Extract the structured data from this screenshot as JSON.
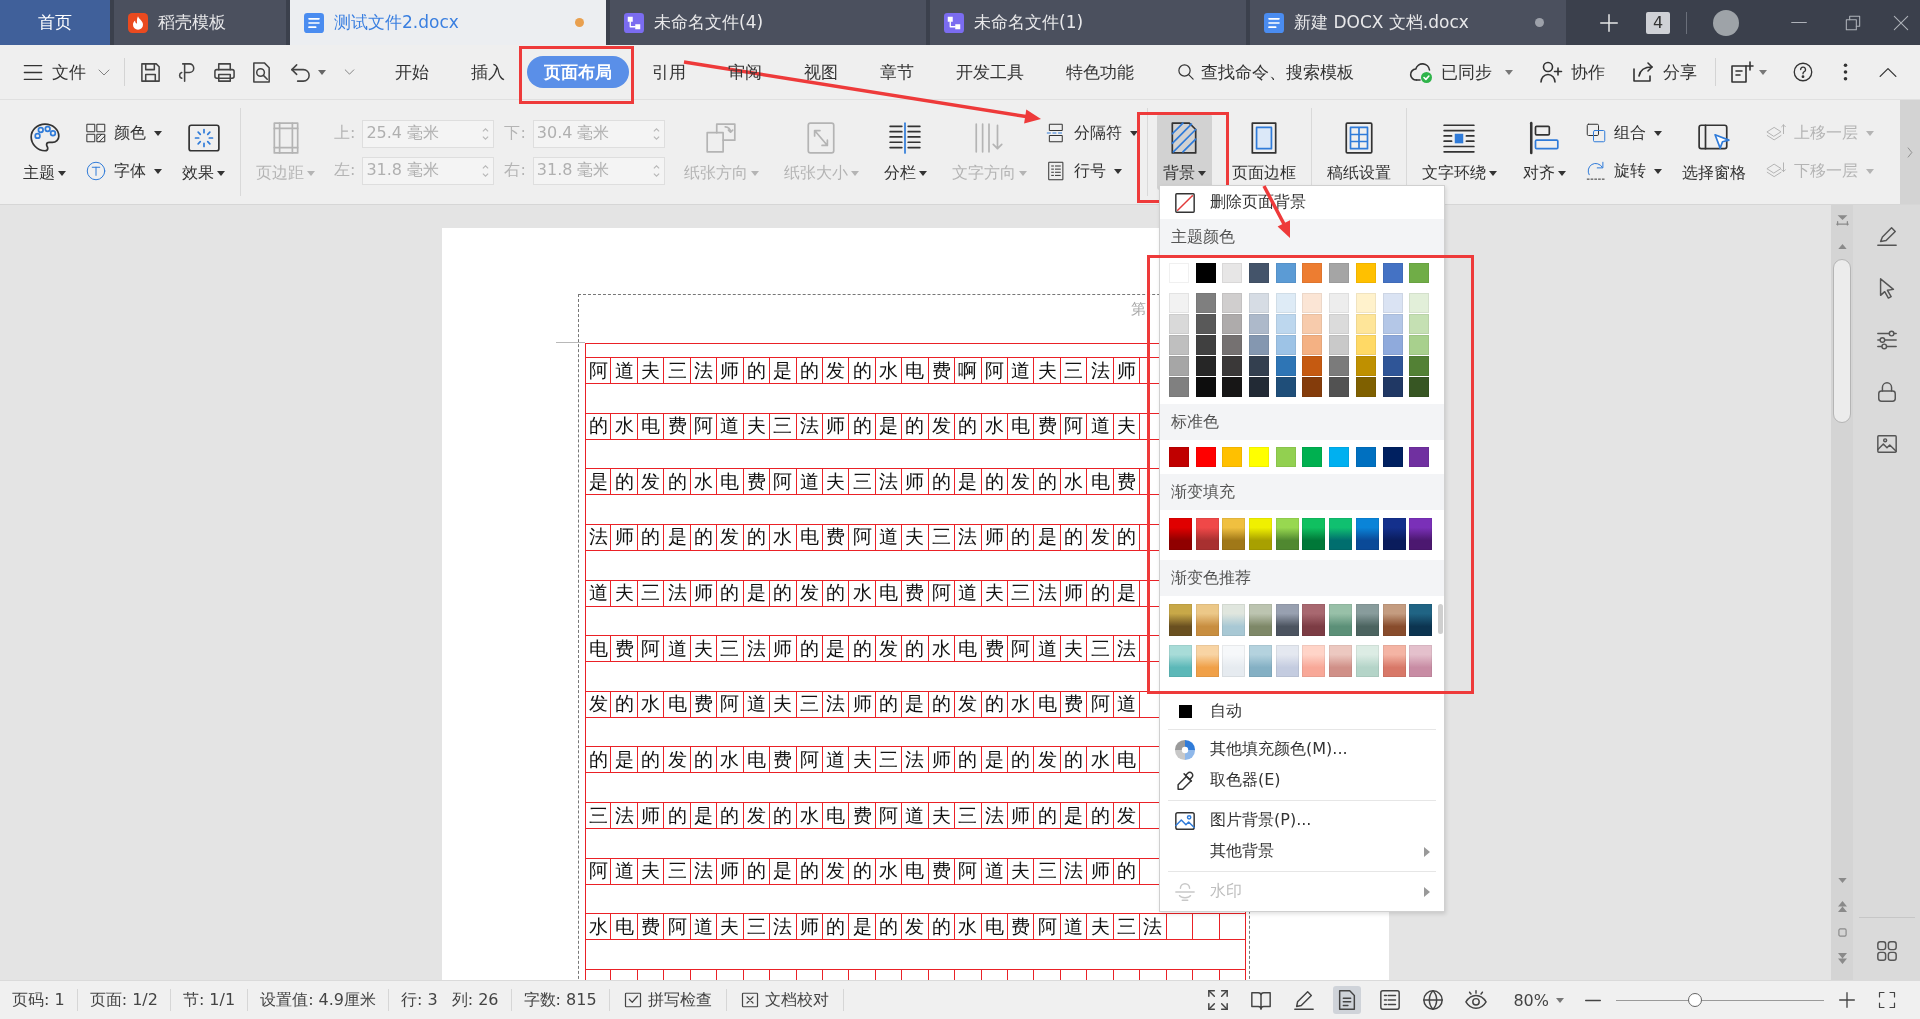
{
  "tab_bar": {
    "tabs": [
      {
        "label": "首页",
        "kind": "home",
        "selected": false,
        "modified": false
      },
      {
        "label": "稻壳模板",
        "kind": "template",
        "selected": false,
        "modified": false
      },
      {
        "label": "测试文件2.docx",
        "kind": "writer",
        "selected": true,
        "modified": true
      },
      {
        "label": "未命名文件(4)",
        "kind": "flowchart",
        "selected": false,
        "modified": false
      },
      {
        "label": "未命名文件(1)",
        "kind": "flowchart",
        "selected": false,
        "modified": false
      },
      {
        "label": "新建 DOCX 文档.docx",
        "kind": "writer",
        "selected": false,
        "modified": true
      }
    ],
    "window_count": "4"
  },
  "menu_bar": {
    "file_label": "文件",
    "tabs": [
      {
        "label": "开始",
        "selected": false,
        "marked": false
      },
      {
        "label": "插入",
        "selected": false,
        "marked": false
      },
      {
        "label": "页面布局",
        "selected": true,
        "marked": true
      },
      {
        "label": "引用",
        "selected": false,
        "marked": false
      },
      {
        "label": "审阅",
        "selected": false,
        "marked": false
      },
      {
        "label": "视图",
        "selected": false,
        "marked": false
      },
      {
        "label": "章节",
        "selected": false,
        "marked": false
      },
      {
        "label": "开发工具",
        "selected": false,
        "marked": false
      },
      {
        "label": "特色功能",
        "selected": false,
        "marked": false
      }
    ],
    "search_label": "查找命令、搜索模板",
    "sync_label": "已同步",
    "collaborate_label": "协作",
    "share_label": "分享"
  },
  "ribbon": {
    "groups": [
      {
        "items": [
          {
            "kind": "large",
            "label": "主题",
            "dropdown": true,
            "disabled": false,
            "selected": false,
            "marked": false
          },
          {
            "kind": "pair",
            "buttons": [
              {
                "label": "颜色",
                "dropdown": true,
                "disabled": false
              },
              {
                "label": "字体",
                "dropdown": true,
                "disabled": false
              }
            ]
          },
          {
            "kind": "large",
            "label": "效果",
            "dropdown": true,
            "disabled": false,
            "selected": false,
            "marked": false
          }
        ]
      },
      {
        "items": [
          {
            "kind": "large",
            "label": "页边距",
            "dropdown": true,
            "disabled": true,
            "selected": false,
            "marked": false
          },
          {
            "kind": "fields",
            "fields": [
              {
                "label": "上:",
                "value": "25.4 毫米",
                "disabled": true
              },
              {
                "label": "左:",
                "value": "31.8 毫米",
                "disabled": true
              },
              {
                "label": "下:",
                "value": "30.4 毫米",
                "disabled": true
              },
              {
                "label": "右:",
                "value": "31.8 毫米",
                "disabled": true
              }
            ]
          },
          {
            "kind": "large",
            "label": "纸张方向",
            "dropdown": true,
            "disabled": true,
            "selected": false,
            "marked": false
          },
          {
            "kind": "large",
            "label": "纸张大小",
            "dropdown": true,
            "disabled": true,
            "selected": false,
            "marked": false
          },
          {
            "kind": "large",
            "label": "分栏",
            "dropdown": true,
            "disabled": false,
            "selected": false,
            "marked": false
          },
          {
            "kind": "large",
            "label": "文字方向",
            "dropdown": true,
            "disabled": true,
            "selected": false,
            "marked": false
          },
          {
            "kind": "pair",
            "buttons": [
              {
                "label": "分隔符",
                "dropdown": true,
                "disabled": false
              },
              {
                "label": "行号",
                "dropdown": true,
                "disabled": false
              }
            ]
          }
        ]
      },
      {
        "items": [
          {
            "kind": "large",
            "label": "背景",
            "dropdown": true,
            "disabled": false,
            "selected": true,
            "marked": true
          },
          {
            "kind": "large",
            "label": "页面边框",
            "dropdown": false,
            "disabled": false,
            "selected": false,
            "marked": false
          }
        ]
      },
      {
        "items": [
          {
            "kind": "large",
            "label": "稿纸设置",
            "dropdown": false,
            "disabled": false,
            "selected": false,
            "marked": false
          }
        ]
      },
      {
        "items": [
          {
            "kind": "large",
            "label": "文字环绕",
            "dropdown": true,
            "disabled": false,
            "selected": false,
            "marked": false
          },
          {
            "kind": "large",
            "label": "对齐",
            "dropdown": true,
            "disabled": false,
            "selected": false,
            "marked": false
          },
          {
            "kind": "pair",
            "buttons": [
              {
                "label": "组合",
                "dropdown": true,
                "disabled": false
              },
              {
                "label": "旋转",
                "dropdown": true,
                "disabled": false
              }
            ]
          },
          {
            "kind": "large",
            "label": "选择窗格",
            "dropdown": false,
            "disabled": false,
            "selected": false,
            "marked": false
          },
          {
            "kind": "pair",
            "buttons": [
              {
                "label": "上移一层",
                "dropdown": true,
                "disabled": true
              },
              {
                "label": "下移一层",
                "dropdown": true,
                "disabled": true
              }
            ]
          }
        ]
      }
    ]
  },
  "document": {
    "header_text": "第",
    "grid_rows": [
      "阿道夫三法师的是的发的水电费啊阿道夫三法师",
      "的水电费阿道夫三法师的是的发的水电费阿道夫",
      "是的发的水电费阿道夫三法师的是的发的水电费",
      "法师的是的发的水电费阿道夫三法师的是的发的",
      "道夫三法师的是的发的水电费阿道夫三法师的是",
      "电费阿道夫三法师的是的发的水电费阿道夫三法",
      "发的水电费阿道夫三法师的是的发的水电费阿道",
      "的是的发的水电费阿道夫三法师的是的发的水电",
      "三法师的是的发的水电费阿道夫三法师的是的发",
      "阿道夫三法师的是的发的水电费阿道夫三法师的",
      "水电费阿道夫三法师的是的发的水电费阿道夫三法"
    ]
  },
  "background_menu": {
    "remove_label": "删除页面背景",
    "marked": true,
    "sections": [
      {
        "title": "主题颜色",
        "kind": "theme",
        "rows": [
          [
            {
              "color": "#ffffff"
            },
            {
              "color": "#000000"
            },
            {
              "color": "#e7e6e6"
            },
            {
              "color": "#44546a"
            },
            {
              "color": "#5b9bd5"
            },
            {
              "color": "#ed7d31"
            },
            {
              "color": "#a5a5a5"
            },
            {
              "color": "#ffc000"
            },
            {
              "color": "#4472c4"
            },
            {
              "color": "#70ad47"
            }
          ],
          [
            {
              "color": "#f2f2f2"
            },
            {
              "color": "#7f7f7f"
            },
            {
              "color": "#d0cece"
            },
            {
              "color": "#d6dce4"
            },
            {
              "color": "#deebf6"
            },
            {
              "color": "#fbe5d5"
            },
            {
              "color": "#ededed"
            },
            {
              "color": "#fff2cc"
            },
            {
              "color": "#dae3f3"
            },
            {
              "color": "#e2efd9"
            }
          ],
          [
            {
              "color": "#d9d9d9"
            },
            {
              "color": "#595959"
            },
            {
              "color": "#aeabab"
            },
            {
              "color": "#adb9ca"
            },
            {
              "color": "#bdd7ee"
            },
            {
              "color": "#f7cbac"
            },
            {
              "color": "#dbdbdb"
            },
            {
              "color": "#fee599"
            },
            {
              "color": "#b4c7e7"
            },
            {
              "color": "#c5e0b3"
            }
          ],
          [
            {
              "color": "#bfbfbf"
            },
            {
              "color": "#404040"
            },
            {
              "color": "#757171"
            },
            {
              "color": "#8497b0"
            },
            {
              "color": "#9dc3e6"
            },
            {
              "color": "#f4b183"
            },
            {
              "color": "#c9c9c9"
            },
            {
              "color": "#ffd965"
            },
            {
              "color": "#8faadc"
            },
            {
              "color": "#a8d08d"
            }
          ],
          [
            {
              "color": "#a6a6a6"
            },
            {
              "color": "#262626"
            },
            {
              "color": "#3a3838"
            },
            {
              "color": "#333f4f"
            },
            {
              "color": "#2e75b5"
            },
            {
              "color": "#c55a11"
            },
            {
              "color": "#7b7b7b"
            },
            {
              "color": "#bf9000"
            },
            {
              "color": "#2f5597"
            },
            {
              "color": "#538135"
            }
          ],
          [
            {
              "color": "#808080"
            },
            {
              "color": "#0d0d0d"
            },
            {
              "color": "#171616"
            },
            {
              "color": "#222a35"
            },
            {
              "color": "#1f4e79"
            },
            {
              "color": "#843c0b"
            },
            {
              "color": "#525252"
            },
            {
              "color": "#7f6000"
            },
            {
              "color": "#203864"
            },
            {
              "color": "#375623"
            }
          ]
        ]
      },
      {
        "title": "标准色",
        "kind": "solid",
        "rows": [
          [
            {
              "color": "#c00000"
            },
            {
              "color": "#ff0000"
            },
            {
              "color": "#ffc000"
            },
            {
              "color": "#ffff00"
            },
            {
              "color": "#92d050"
            },
            {
              "color": "#00b050"
            },
            {
              "color": "#00b0f0"
            },
            {
              "color": "#0070c0"
            },
            {
              "color": "#002060"
            },
            {
              "color": "#7030a0"
            }
          ]
        ]
      },
      {
        "title": "渐变填充",
        "kind": "gradient",
        "rows": [
          [
            {
              "top": {
                "color": "#e00000"
              },
              "bottom": {
                "color": "#900000"
              }
            },
            {
              "top": {
                "color": "#f04848"
              },
              "bottom": {
                "color": "#a83030"
              }
            },
            {
              "top": {
                "color": "#f0c040"
              },
              "bottom": {
                "color": "#a07818"
              }
            },
            {
              "top": {
                "color": "#f0f000"
              },
              "bottom": {
                "color": "#a8a000"
              }
            },
            {
              "top": {
                "color": "#98d850"
              },
              "bottom": {
                "color": "#508830"
              }
            },
            {
              "top": {
                "color": "#10c060"
              },
              "bottom": {
                "color": "#007838"
              }
            },
            {
              "top": {
                "color": "#10c070"
              },
              "bottom": {
                "color": "#006e6e"
              }
            },
            {
              "top": {
                "color": "#0a84d8"
              },
              "bottom": {
                "color": "#0a4a98"
              }
            },
            {
              "top": {
                "color": "#14308c"
              },
              "bottom": {
                "color": "#0a1c5c"
              }
            },
            {
              "top": {
                "color": "#7a30b8"
              },
              "bottom": {
                "color": "#4c1870"
              }
            }
          ]
        ]
      },
      {
        "title": "渐变色推荐",
        "kind": "gradient",
        "rows": [
          [
            {
              "top": {
                "color": "#c8a848"
              },
              "bottom": {
                "color": "#6a5020"
              }
            },
            {
              "top": {
                "color": "#ecc888"
              },
              "bottom": {
                "color": "#c88e40"
              }
            },
            {
              "top": {
                "color": "#e0e6de"
              },
              "bottom": {
                "color": "#a8c8d4"
              }
            },
            {
              "top": {
                "color": "#bcc4b0"
              },
              "bottom": {
                "color": "#7e8868"
              }
            },
            {
              "top": {
                "color": "#98a0b0"
              },
              "bottom": {
                "color": "#4c5460"
              }
            },
            {
              "top": {
                "color": "#a86870"
              },
              "bottom": {
                "color": "#7c3c44"
              }
            },
            {
              "top": {
                "color": "#98c0a8"
              },
              "bottom": {
                "color": "#5c9078"
              }
            },
            {
              "top": {
                "color": "#889c9c"
              },
              "bottom": {
                "color": "#4c6460"
              }
            },
            {
              "top": {
                "color": "#c49c80"
              },
              "bottom": {
                "color": "#884c2c"
              }
            },
            {
              "top": {
                "color": "#206484"
              },
              "bottom": {
                "color": "#0c3450"
              }
            }
          ],
          [
            {
              "top": {
                "color": "#a8dcd8"
              },
              "bottom": {
                "color": "#5cb8b8"
              }
            },
            {
              "top": {
                "color": "#f8d4a4"
              },
              "bottom": {
                "color": "#f0a048"
              }
            },
            {
              "top": {
                "color": "#f6f8fa"
              },
              "bottom": {
                "color": "#e6ebf0"
              }
            },
            {
              "top": {
                "color": "#b4d2de"
              },
              "bottom": {
                "color": "#84b0c4"
              }
            },
            {
              "top": {
                "color": "#e4e8f0"
              },
              "bottom": {
                "color": "#c4cce0"
              }
            },
            {
              "top": {
                "color": "#ffd4c8"
              },
              "bottom": {
                "color": "#f8a898"
              }
            },
            {
              "top": {
                "color": "#ecc8c0"
              },
              "bottom": {
                "color": "#d09088"
              }
            },
            {
              "top": {
                "color": "#dcece4"
              },
              "bottom": {
                "color": "#b4d4c8"
              }
            },
            {
              "top": {
                "color": "#f4b4a4"
              },
              "bottom": {
                "color": "#d87868"
              }
            },
            {
              "top": {
                "color": "#e4c0cc"
              },
              "bottom": {
                "color": "#c88ca4"
              }
            }
          ]
        ]
      }
    ],
    "item_groups": [
      [
        {
          "label": "自动",
          "submenu": false,
          "disabled": false
        }
      ],
      [
        {
          "label": "其他填充颜色(M)...",
          "submenu": false,
          "disabled": false
        },
        {
          "label": "取色器(E)",
          "submenu": false,
          "disabled": false
        }
      ],
      [
        {
          "label": "图片背景(P)...",
          "submenu": false,
          "disabled": false
        },
        {
          "label": "其他背景",
          "submenu": true,
          "disabled": false
        }
      ],
      [
        {
          "label": "水印",
          "submenu": true,
          "disabled": true
        }
      ]
    ]
  },
  "status_bar": {
    "segments": [
      [
        "页码: 1"
      ],
      [
        "页面: 1/2"
      ],
      [
        "节: 1/1"
      ],
      [
        "设置值: 4.9厘米"
      ],
      [
        "行: 3",
        "列: 26"
      ],
      [
        "字数: 815"
      ]
    ],
    "tools": [
      "拼写检查",
      "文档校对"
    ],
    "view_buttons": [
      {
        "selected": false
      },
      {
        "selected": false
      },
      {
        "selected": false
      },
      {
        "selected": true
      },
      {
        "selected": false
      },
      {
        "selected": false
      },
      {
        "selected": false
      }
    ],
    "zoom_label": "80%",
    "zoom": {
      "level": 0.38
    }
  }
}
